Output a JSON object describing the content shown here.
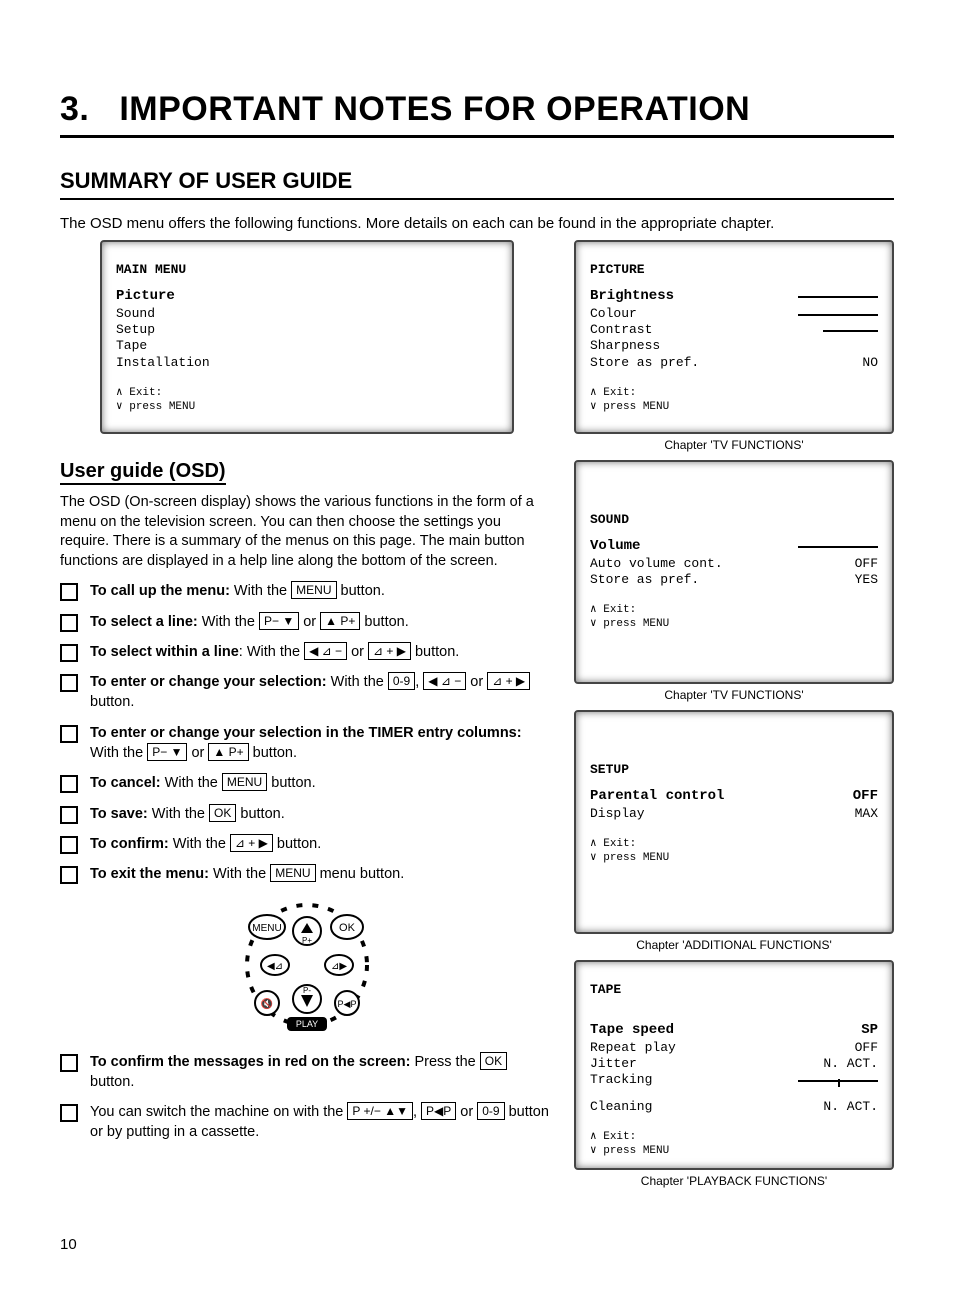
{
  "chapter_num": "3.",
  "chapter_title": "IMPORTANT NOTES FOR OPERATION",
  "section_title": "SUMMARY OF USER GUIDE",
  "intro": "The OSD menu offers the following functions. More details on each can be found in the appropriate chapter.",
  "main_menu": {
    "title": "MAIN MENU",
    "highlight": "Picture",
    "items": [
      "Sound",
      "Setup",
      "Tape",
      "Installation"
    ],
    "exit1": "∧ Exit:",
    "exit2": "∨ press MENU"
  },
  "sub_title": "User guide (OSD)",
  "body": "The OSD (On-screen display) shows the various functions in the form of a menu on the television screen. You can then choose the settings you require. There is a summary of the menus on this page. The main button functions are displayed in a help line along the bottom of the screen.",
  "list": {
    "i1_bold": "To call up the menu:",
    "i1_rest": " With the ",
    "i1_key": "MENU",
    "i1_end": " button.",
    "i2_bold": "To select a line:",
    "i2_rest": " With the ",
    "i2_key1": "P− ▼",
    "i2_mid": " or ",
    "i2_key2": "▲ P+",
    "i2_end": " button.",
    "i3_bold": "To select within a line",
    "i3_rest": ": With the ",
    "i3_key1": "◀ ⊿ −",
    "i3_mid": " or ",
    "i3_key2": "⊿ + ▶",
    "i3_end": " button.",
    "i4_bold": "To enter or change your selection:",
    "i4_rest": " With the ",
    "i4_key1": "0-9",
    "i4_mid1": ", ",
    "i4_key2": "◀ ⊿ −",
    "i4_mid2": " or ",
    "i4_key3": "⊿ + ▶",
    "i4_end": " button.",
    "i5_bold": "To enter or change your selection in the TIMER entry columns:",
    "i5_rest": " With the ",
    "i5_key1": "P− ▼",
    "i5_mid": " or ",
    "i5_key2": "▲ P+",
    "i5_end": " button.",
    "i6_bold": "To cancel:",
    "i6_rest": " With the ",
    "i6_key": "MENU",
    "i6_end": " button.",
    "i7_bold": "To save:",
    "i7_rest": " With the ",
    "i7_key": "OK",
    "i7_end": " button.",
    "i8_bold": "To confirm:",
    "i8_rest": " With the ",
    "i8_key": "⊿ + ▶",
    "i8_end": " button.",
    "i9_bold": "To exit the menu:",
    "i9_rest": " With the ",
    "i9_key": "MENU",
    "i9_end": " menu button.",
    "i10_bold": "To confirm the messages in red on the screen:",
    "i10_rest": " Press the ",
    "i10_key": "OK",
    "i10_end": " button.",
    "i11_pre": "You can switch the machine on with the ",
    "i11_key1": "P +/− ▲▼",
    "i11_mid1": ", ",
    "i11_key2": "P◀P",
    "i11_mid2": " or ",
    "i11_key3": "0-9",
    "i11_end": " button or by putting in a cassette."
  },
  "remote_labels": {
    "menu": "MENU",
    "ok": "OK",
    "play": "PLAY",
    "pplus": "P+",
    "pminus": "P-"
  },
  "picture_screen": {
    "title": "PICTURE",
    "highlight": "Brightness",
    "rows": [
      {
        "label": "Colour",
        "val_type": "slider"
      },
      {
        "label": "Contrast",
        "val_type": "slider_short"
      },
      {
        "label": "Sharpness",
        "val_type": ""
      },
      {
        "label": "Store as pref.",
        "val": "NO"
      }
    ],
    "exit1": "∧ Exit:",
    "exit2": "∨ press MENU",
    "caption": "Chapter 'TV FUNCTIONS'"
  },
  "sound_screen": {
    "title": "SOUND",
    "highlight": "Volume",
    "rows": [
      {
        "label": "Auto volume cont.",
        "val": "OFF"
      },
      {
        "label": "Store as pref.",
        "val": "YES"
      }
    ],
    "exit1": "∧ Exit:",
    "exit2": "∨ press MENU",
    "caption": "Chapter 'TV FUNCTIONS'"
  },
  "setup_screen": {
    "title": "SETUP",
    "rows": [
      {
        "label": "Parental control",
        "val": "OFF",
        "highlight": true
      },
      {
        "label": "Display",
        "val": "MAX"
      }
    ],
    "exit1": "∧ Exit:",
    "exit2": "∨ press MENU",
    "caption": "Chapter 'ADDITIONAL FUNCTIONS'"
  },
  "tape_screen": {
    "title": "TAPE",
    "rows": [
      {
        "label": "Tape speed",
        "val": "SP",
        "highlight": true
      },
      {
        "label": "Repeat play",
        "val": "OFF"
      },
      {
        "label": "Jitter",
        "val": "N. ACT."
      },
      {
        "label": "Tracking",
        "val_type": "slider_tick"
      },
      {
        "label": "Cleaning",
        "val": "N. ACT."
      }
    ],
    "exit1": "∧ Exit:",
    "exit2": "∨ press MENU",
    "caption": "Chapter 'PLAYBACK FUNCTIONS'"
  },
  "page_number": "10"
}
